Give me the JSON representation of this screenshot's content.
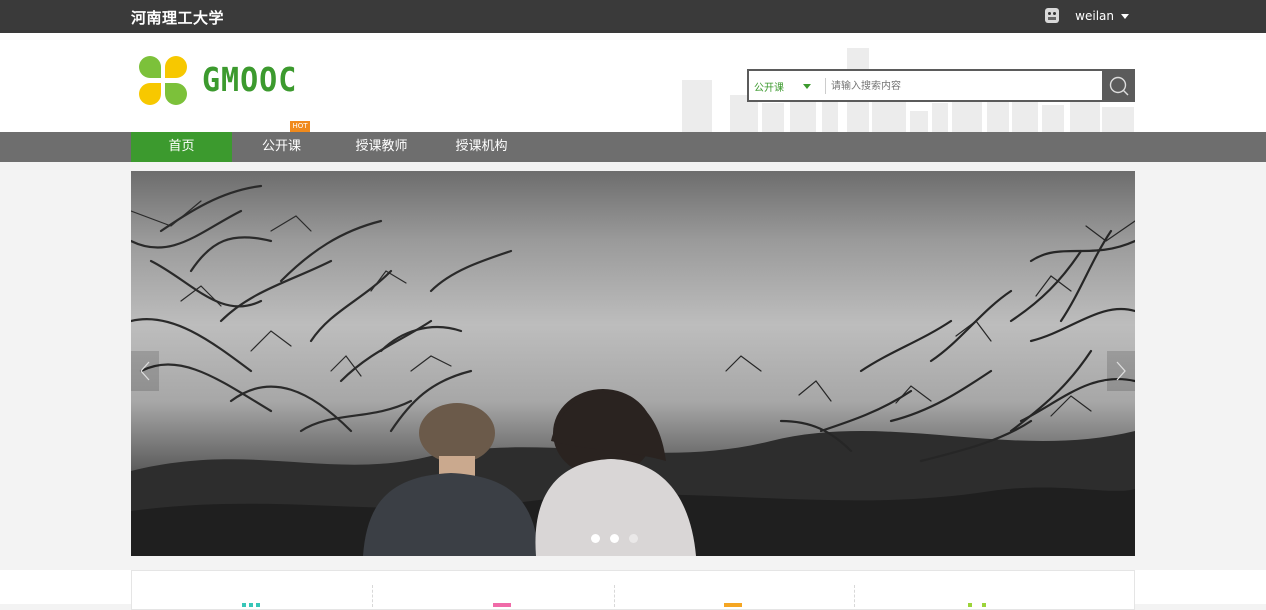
{
  "topbar": {
    "university": "河南理工大学",
    "username": "weilan",
    "avatar_icon": "avatar-icon",
    "dropdown_icon": "caret-down-icon"
  },
  "header": {
    "logo_text": "GMOOC",
    "search": {
      "category": "公开课",
      "placeholder": "请输入搜索内容",
      "button_icon": "search-icon"
    }
  },
  "nav": {
    "items": [
      {
        "label": "首页",
        "active": true
      },
      {
        "label": "公开课",
        "badge": "HOT"
      },
      {
        "label": "授课教师"
      },
      {
        "label": "授课机构"
      }
    ]
  },
  "banner": {
    "slide_count": 3,
    "active_index": 1
  },
  "colors": {
    "brand_green": "#3c9a2e",
    "topbar_bg": "#3a3a3a",
    "nav_bg": "#6e6e6e",
    "hot_badge": "#f08a1c",
    "logo_yellow": "#f7c800"
  },
  "features": {
    "icons": [
      "feature-icon-teal",
      "feature-icon-pink",
      "feature-icon-orange",
      "feature-icon-green"
    ]
  }
}
